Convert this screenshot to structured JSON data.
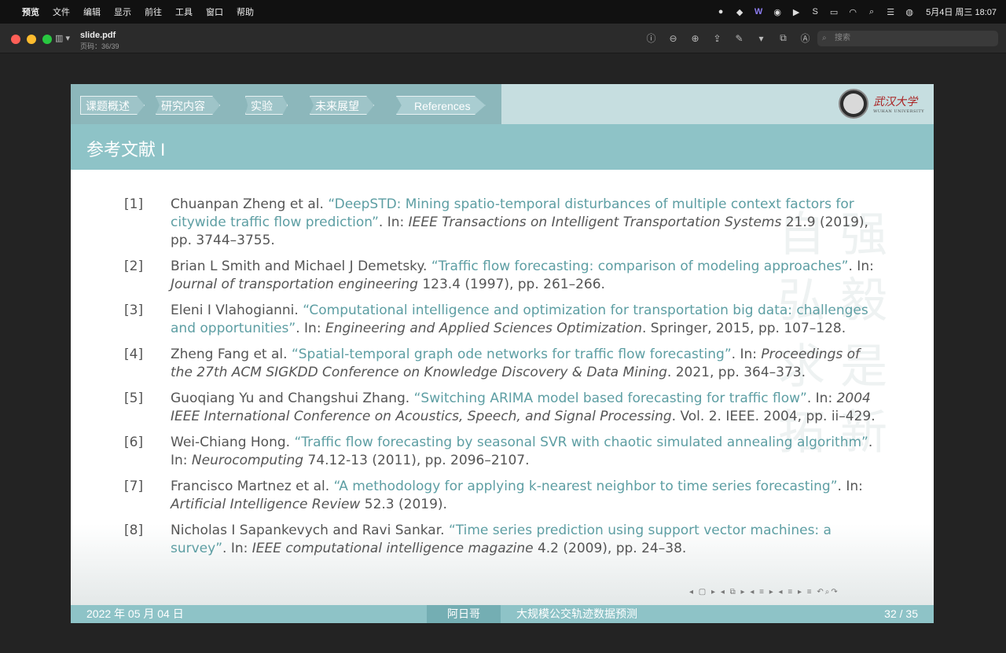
{
  "menubar": {
    "apple": "",
    "items": [
      "预览",
      "文件",
      "编辑",
      "显示",
      "前往",
      "工具",
      "窗口",
      "帮助"
    ],
    "clock": "5月4日 周三  18:07"
  },
  "toolbar": {
    "title": "slide.pdf",
    "subtitle": "页码：36/39",
    "search_placeholder": "搜索"
  },
  "slide": {
    "nav": [
      "课题概述",
      "研究内容",
      "实验",
      "未来展望",
      "References"
    ],
    "logo_text": "武汉大学",
    "logo_sub": "WUHAN UNIVERSITY",
    "title": "参考文献 I",
    "references": [
      {
        "num": "[1]",
        "authors": "Chuanpan Zheng et al. ",
        "title": "“DeepSTD: Mining spatio-temporal disturbances of multiple context factors for citywide traffic flow prediction”",
        "mid": ". In: ",
        "venue": "IEEE Transactions on Intelligent Transportation Systems",
        "tail": " 21.9 (2019), pp. 3744–3755."
      },
      {
        "num": "[2]",
        "authors": "Brian L Smith and Michael J Demetsky. ",
        "title": "“Traffic flow forecasting: comparison of modeling approaches”",
        "mid": ". In: ",
        "venue": "Journal of transportation engineering",
        "tail": " 123.4 (1997), pp. 261–266."
      },
      {
        "num": "[3]",
        "authors": "Eleni I Vlahogianni. ",
        "title": "“Computational intelligence and optimization for transportation big data: challenges and opportunities”",
        "mid": ". In: ",
        "venue": "Engineering and Applied Sciences Optimization",
        "tail": ". Springer, 2015, pp. 107–128."
      },
      {
        "num": "[4]",
        "authors": "Zheng Fang et al. ",
        "title": "“Spatial-temporal graph ode networks for traffic flow forecasting”",
        "mid": ". In: ",
        "venue": "Proceedings of the 27th ACM SIGKDD Conference on Knowledge Discovery & Data Mining",
        "tail": ". 2021, pp. 364–373."
      },
      {
        "num": "[5]",
        "authors": "Guoqiang Yu and Changshui Zhang. ",
        "title": "“Switching ARIMA model based forecasting for traffic flow”",
        "mid": ". In: ",
        "venue": "2004 IEEE International Conference on Acoustics, Speech, and Signal Processing",
        "tail": ". Vol. 2. IEEE. 2004, pp. ii–429."
      },
      {
        "num": "[6]",
        "authors": "Wei-Chiang Hong. ",
        "title": "“Traffic flow forecasting by seasonal SVR with chaotic simulated annealing algorithm”",
        "mid": ". In: ",
        "venue": "Neurocomputing",
        "tail": " 74.12-13 (2011), pp. 2096–2107."
      },
      {
        "num": "[7]",
        "authors": "Francisco Martnez et al. ",
        "title": "“A methodology for applying k-nearest neighbor to time series forecasting”",
        "mid": ". In: ",
        "venue": "Artificial Intelligence Review",
        "tail": " 52.3 (2019)."
      },
      {
        "num": "[8]",
        "authors": "Nicholas I Sapankevych and Ravi Sankar. ",
        "title": "“Time series prediction using support vector machines: a survey”",
        "mid": ". In: ",
        "venue": "IEEE computational intelligence magazine",
        "tail": " 4.2 (2009), pp. 24–38."
      }
    ],
    "footer": {
      "date": "2022 年 05 月 04 日",
      "author": "阿日哥",
      "subject": "大规模公交轨迹数据预测",
      "page": "32 /  35"
    }
  }
}
